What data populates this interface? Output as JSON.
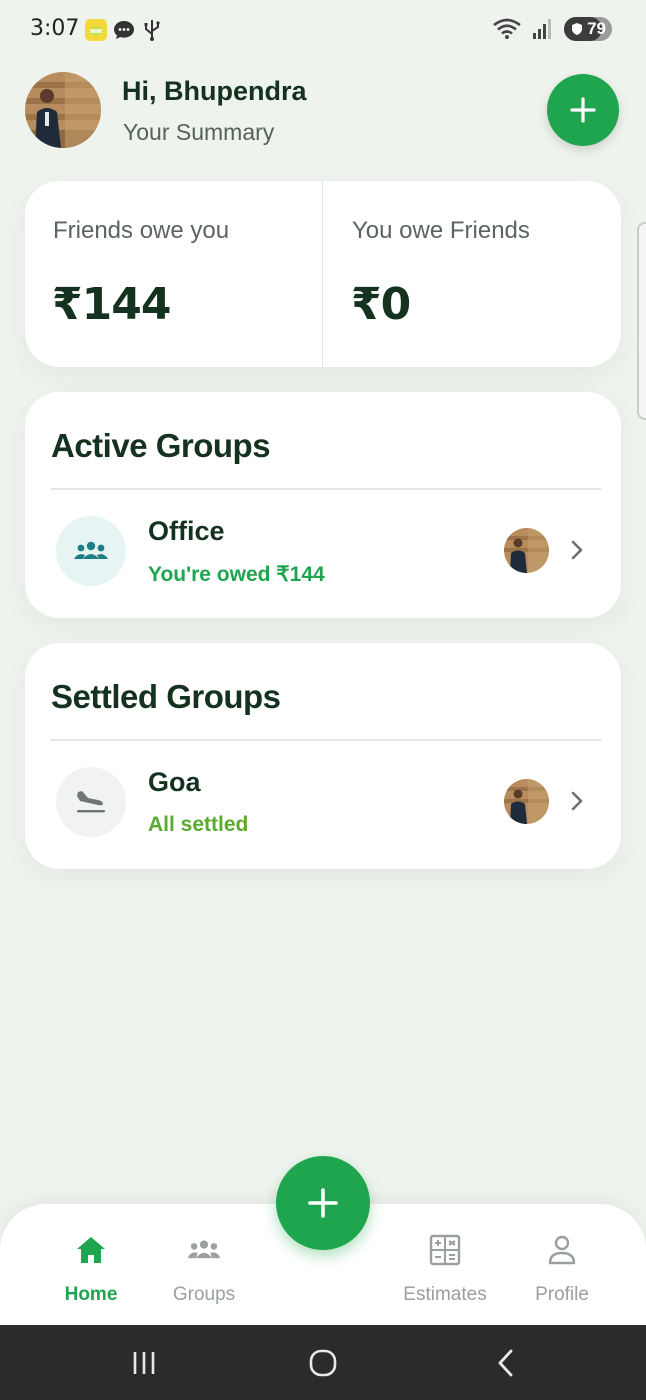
{
  "status_bar": {
    "time": "3:07",
    "battery": "79",
    "battery_level": 0.79
  },
  "header": {
    "greeting": "Hi, Bhupendra",
    "subtitle": "Your Summary"
  },
  "summary": {
    "friends_owe_label": "Friends owe you",
    "friends_owe_value": "₹144",
    "you_owe_label": "You owe Friends",
    "you_owe_value": "₹0"
  },
  "active_groups": {
    "title": "Active Groups",
    "items": [
      {
        "name": "Office",
        "status": "You're owed ₹144",
        "icon": "people-group-icon"
      }
    ]
  },
  "settled_groups": {
    "title": "Settled Groups",
    "items": [
      {
        "name": "Goa",
        "status": "All settled",
        "icon": "flight-land-icon"
      }
    ]
  },
  "bottom_nav": {
    "items": [
      {
        "label": "Home",
        "icon": "home-icon",
        "active": true
      },
      {
        "label": "Groups",
        "icon": "groups-icon",
        "active": false
      },
      {
        "label": "Estimates",
        "icon": "calculator-icon",
        "active": false
      },
      {
        "label": "Profile",
        "icon": "person-icon",
        "active": false
      }
    ]
  },
  "colors": {
    "accent": "#1fa54e",
    "text_dark": "#14321f",
    "owed_green": "#1fa54e",
    "settled_green": "#5aab2e",
    "background": "#eff3ee"
  }
}
